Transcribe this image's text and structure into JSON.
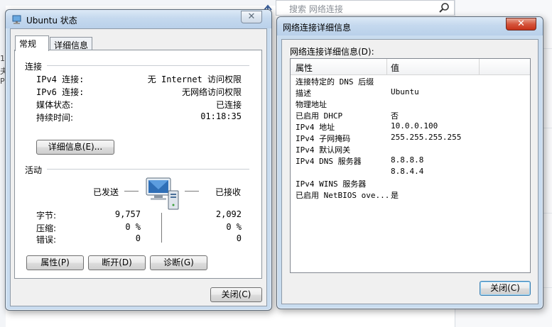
{
  "background": {
    "search_placeholder": "搜索 网络连接",
    "icons": [
      "search-icon",
      "nav-arrow-icon"
    ],
    "left_edge_fragments": [
      "1",
      "夫",
      "P"
    ]
  },
  "status_window": {
    "title": "Ubuntu 状态",
    "close_glyph": "✕",
    "tabs": [
      "常规",
      "详细信息"
    ],
    "connection": {
      "heading": "连接",
      "rows": [
        {
          "label": "IPv4 连接:",
          "value": "无 Internet 访问权限"
        },
        {
          "label": "IPv6 连接:",
          "value": "无网络访问权限"
        },
        {
          "label": "媒体状态:",
          "value": "已连接"
        },
        {
          "label": "持续时间:",
          "value": "01:18:35"
        }
      ],
      "details_button": "详细信息(E)..."
    },
    "activity": {
      "heading": "活动",
      "sent_label": "已发送",
      "received_label": "已接收",
      "rows": [
        {
          "label": "字节:",
          "sent": "9,757",
          "received": "2,092"
        },
        {
          "label": "压缩:",
          "sent": "0 %",
          "received": "0 %"
        },
        {
          "label": "错误:",
          "sent": "0",
          "received": "0"
        }
      ]
    },
    "buttons": {
      "properties": "属性(P)",
      "disable": "断开(D)",
      "diagnose": "诊断(G)",
      "close": "关闭(C)"
    }
  },
  "details_window": {
    "title": "网络连接详细信息",
    "close_glyph": "✕",
    "list_label": "网络连接详细信息(D):",
    "columns": [
      "属性",
      "值"
    ],
    "rows": [
      {
        "property": "连接特定的 DNS 后缀",
        "value": ""
      },
      {
        "property": "描述",
        "value": "Ubuntu"
      },
      {
        "property": "物理地址",
        "value": ""
      },
      {
        "property": "已启用 DHCP",
        "value": "否"
      },
      {
        "property": "IPv4 地址",
        "value": "10.0.0.100"
      },
      {
        "property": "IPv4 子网掩码",
        "value": "255.255.255.255"
      },
      {
        "property": "IPv4 默认网关",
        "value": ""
      },
      {
        "property": "IPv4 DNS 服务器",
        "value": "8.8.8.8"
      },
      {
        "property": "",
        "value": "8.8.4.4"
      },
      {
        "property": "IPv4 WINS 服务器",
        "value": ""
      },
      {
        "property": "已启用 NetBIOS ove...",
        "value": "是"
      }
    ],
    "close_button": "关闭(C)"
  }
}
